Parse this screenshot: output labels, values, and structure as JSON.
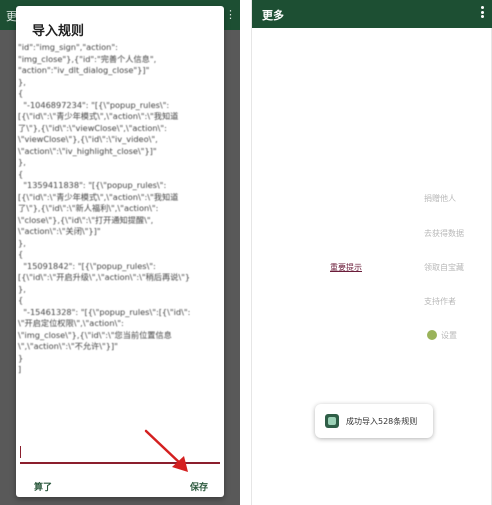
{
  "left": {
    "dialog_title": "导入规则",
    "editor_lines": [
      "\"id\":\"img_sign\",\"action\":",
      "\"img_close\"},{\"id\":\"完善个人信息\",",
      "\"action\":\"iv_dlt_dialog_close\"}]\"",
      "},",
      "{",
      "  \"-1046897234\": \"[{\\\"popup_rules\\\":",
      "[{\\\"id\\\":\\\"青少年模式\\\",\\\"action\\\":\\\"我知道",
      "了\\\"},{\\\"id\\\":\\\"viewClose\\\",\\\"action\\\":",
      "\\\"viewClose\\\"},{\\\"id\\\":\\\"iv_video\\\",",
      "\\\"action\\\":\\\"iv_highlight_close\\\"}]\"",
      "},",
      "{",
      "  \"1359411838\": \"[{\\\"popup_rules\\\":",
      "[{\\\"id\\\":\\\"青少年模式\\\",\\\"action\\\":\\\"我知道",
      "了\\\"},{\\\"id\\\":\\\"新人福利\\\",\\\"action\\\":",
      "\\\"close\\\"},{\\\"id\\\":\\\"打开通知提醒\\\",",
      "\\\"action\\\":\\\"关闭\\\"}]\"",
      "},",
      "{",
      "  \"15091842\": \"[{\\\"popup_rules\\\":",
      "[{\\\"id\\\":\\\"开启升级\\\",\\\"action\\\":\\\"稍后再说\\\"}",
      "},",
      "{",
      "  \"-15461328\": \"[{\\\"popup_rules\\\":[{\\\"id\\\":",
      "\\\"开启定位权限\\\",\\\"action\\\":",
      "\\\"img_close\\\"},{\\\"id\\\":\\\"您当前位置信息",
      "\\\",\\\"action\\\":\\\"不允许\\\"}]\"",
      "}",
      "]"
    ],
    "cancel_label": "算了",
    "save_label": "保存",
    "appbar_stub": "更",
    "appbar_dots": "⋮"
  },
  "right": {
    "title": "更多",
    "important_link": "重要提示",
    "menu_items": [
      "捐赠他人",
      "去获得数据",
      "领取自宝藏",
      "支持作者"
    ],
    "settings_label": "设置",
    "toast_text": "成功导入528条规则"
  },
  "colors": {
    "appbar": "#1d4f33",
    "accent_red": "#8b1e2d",
    "button_green": "#2d5a3f",
    "link": "#6b1d3a"
  },
  "icons": {
    "overflow": "vertical-dots-icon",
    "toast": "app-icon",
    "settings": "gear-icon",
    "arrow": "red-arrow-icon"
  }
}
